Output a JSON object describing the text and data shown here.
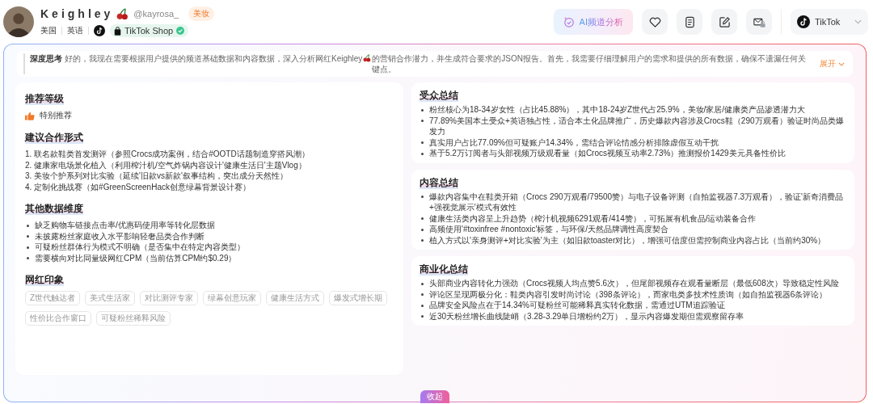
{
  "profile": {
    "name": "Keighley",
    "handle": "@kayrosa_",
    "category_tag": "美妆",
    "country": "美国",
    "language": "英语",
    "shop_badge": "TikTok Shop",
    "shop_verified": true
  },
  "toolbar": {
    "ai_button": "AI频道分析",
    "platform_select": "TikTok"
  },
  "thinking": {
    "label": "深度思考",
    "text_before": "好的，我现在需要根据用户提供的频道基础数据和内容数据，深入分析网红Keighley",
    "text_after": "的营销合作潜力，并生成符合要求的JSON报告。首先，我需要仔细理解用户的需求和提供的所有数据，确保不遗漏任何关键点。",
    "toggle": "展开"
  },
  "left_panel": {
    "sections": [
      {
        "kind": "rating",
        "title": "推荐等级",
        "value": "特别推荐"
      },
      {
        "kind": "ordered",
        "title": "建议合作形式",
        "items": [
          "1. 联名款鞋类首发测评（参照Crocs成功案例，结合#OOTD话题制造穿搭风潮）",
          "2. 健康家电场景化植入（利用榨汁机/空气炸锅内容设计'健康生活日'主题Vlog）",
          "3. 美妆个护系列对比实验（延续'旧款vs新款'叙事结构，突出成分天然性）",
          "4. 定制化挑战赛（如#GreenScreenHack创意绿幕背景设计赛）"
        ]
      },
      {
        "kind": "bullets",
        "title": "其他数据维度",
        "items": [
          "缺乏购物车链接点击率/优惠码使用率等转化层数据",
          "未披露粉丝家庭收入水平影响轻奢品类合作判断",
          "可疑粉丝群体行为模式不明确（是否集中在特定内容类型）",
          "需要横向对比同量级网红CPM（当前估算CPM约$0.29）"
        ]
      },
      {
        "kind": "tags",
        "title": "网红印象",
        "items": [
          "Z世代触达者",
          "美式生活家",
          "对比测评专家",
          "绿幕创意玩家",
          "健康生活方式",
          "爆发式增长期",
          "性价比合作窗口",
          "可疑粉丝稀释风险"
        ]
      }
    ]
  },
  "right_panels": [
    {
      "title": "受众总结",
      "items": [
        "粉丝核心为18-34岁女性（占比45.88%），其中18-24岁Z世代占25.9%，美妆/家居/健康类产品渗透潜力大",
        "77.89%美国本土受众+英语独占性，适合本土化品牌推广，历史爆款内容涉及Crocs鞋（290万观看）验证时尚品类爆发力",
        "真实用户占比77.09%但可疑账户14.34%，需结合评论情感分析排除虚假互动干扰",
        "基于5.2万订阅者与头部视频万级观看量（如Crocs视频互动率2.73%）推测报价1429美元具备性价比"
      ]
    },
    {
      "title": "内容总结",
      "items": [
        "爆款内容集中在鞋类开箱（Crocs 290万观看/79500赞）与电子设备评测（自拍监视器7.3万观看），验证'新奇消费品+强视觉展示'模式有效性",
        "健康生活类内容呈上升趋势（榨汁机视频6291观看/414赞），可拓展有机食品/运动装备合作",
        "高频使用'#toxinfree #nontoxic'标签，与环保/天然品牌调性高度契合",
        "植入方式以'亲身测评+对比实验'为主（如旧款toaster对比），增强可信度但需控制商业内容占比（当前约30%）"
      ]
    },
    {
      "title": "商业化总结",
      "items": [
        "头部商业内容转化力强劲（Crocs视频人均点赞5.6次），但尾部视频存在观看量断层（最低608次）导致稳定性风险",
        "评论区呈现两极分化：鞋类内容引发时尚讨论（398条评论），而家电类多技术性质询（如自拍监视器6条评论）",
        "品牌安全风险点在于14.34%可疑粉丝可能稀释真实转化数据，需通过UTM追踪验证",
        "近30天粉丝增长曲线陡峭（3.28-3.29单日增粉约2万），显示内容爆发期但需观察留存率"
      ]
    }
  ],
  "collapse_button": "收起"
}
